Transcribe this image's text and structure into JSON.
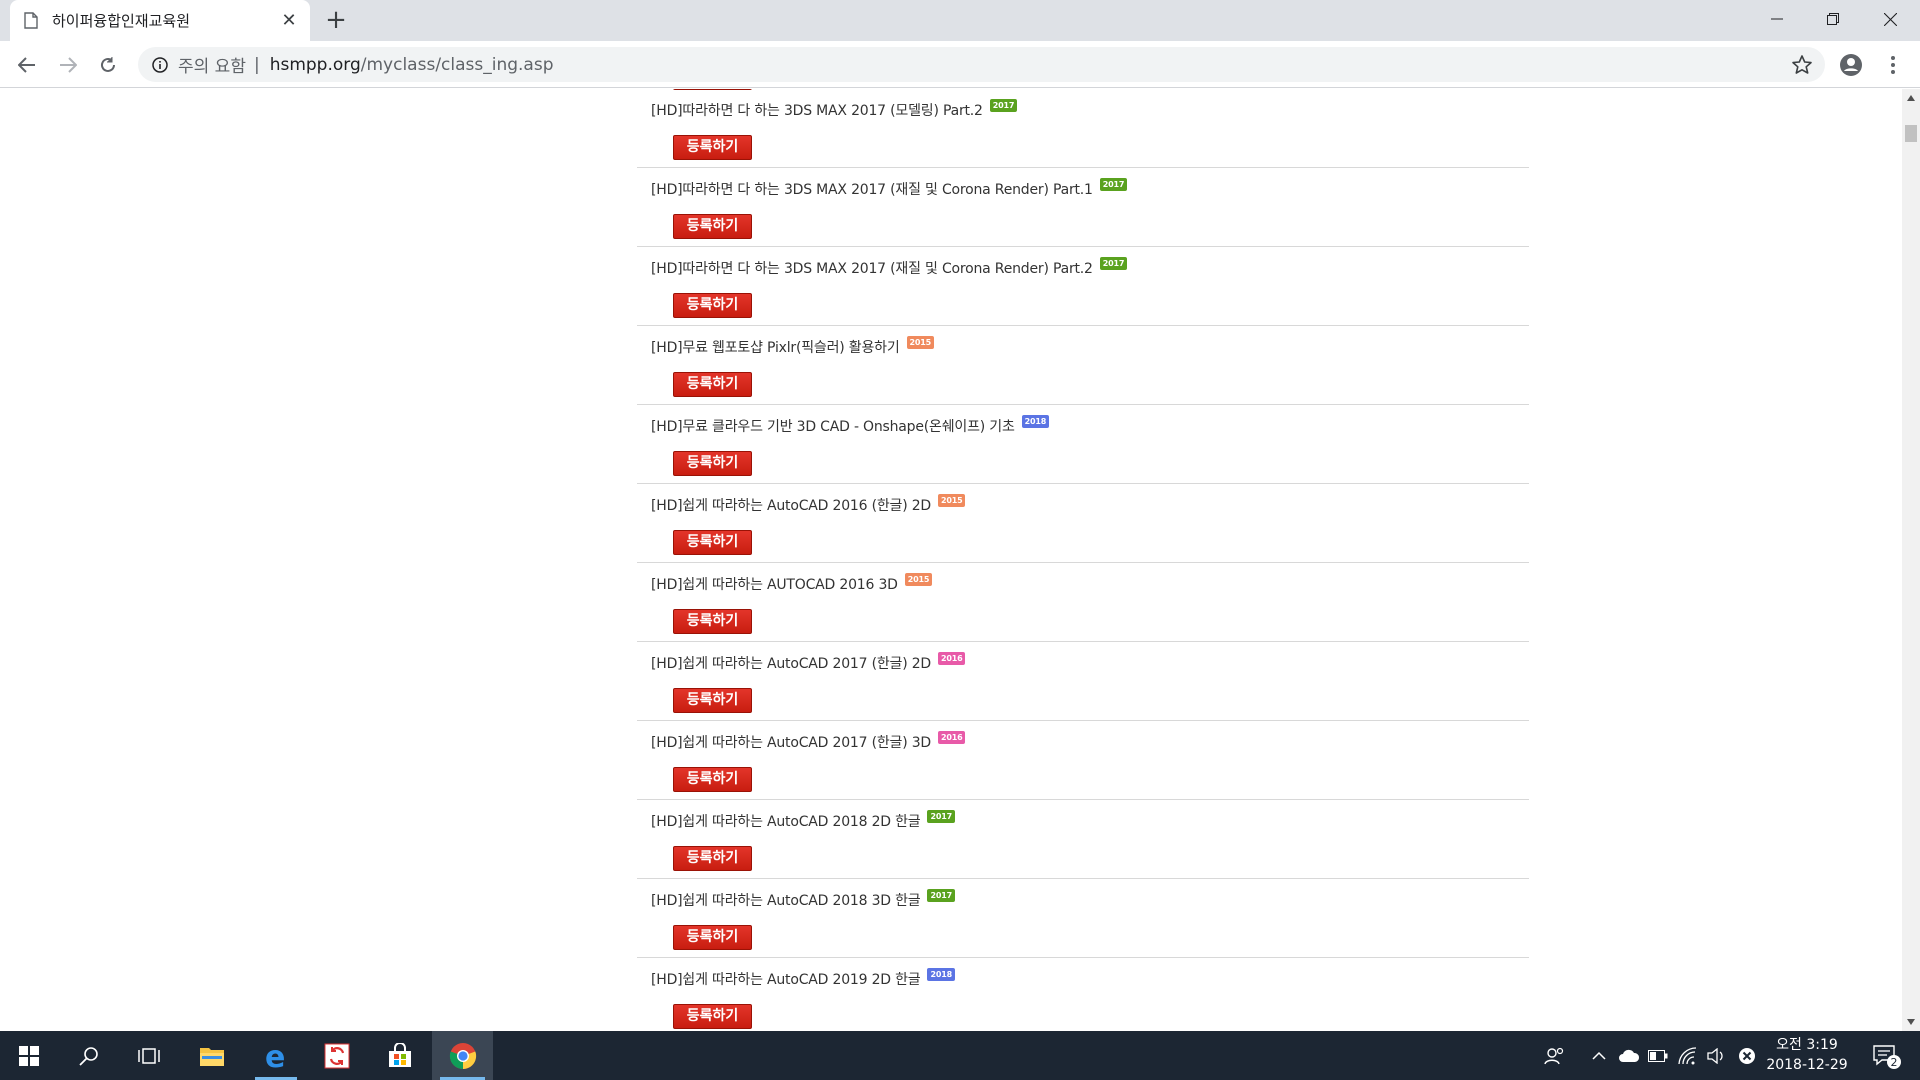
{
  "browser": {
    "tab_title": "하이퍼융합인재교육원",
    "tab_close": "✕",
    "new_tab": "+",
    "security_warning": "주의 요함",
    "separator": "|",
    "url_host": "hsmpp.org",
    "url_path": "/myclass/class_ing.asp"
  },
  "page": {
    "register_label": "등록하기",
    "courses": [
      {
        "title": "[HD]따라하면 다 하는 3DS MAX 2017 (모델링) Part.2",
        "badge": "2017",
        "badge_color": "#5aa21f"
      },
      {
        "title": "[HD]따라하면 다 하는 3DS MAX 2017 (재질 및 Corona Render) Part.1",
        "badge": "2017",
        "badge_color": "#5aa21f"
      },
      {
        "title": "[HD]따라하면 다 하는 3DS MAX 2017 (재질 및 Corona Render) Part.2",
        "badge": "2017",
        "badge_color": "#5aa21f"
      },
      {
        "title": "[HD]무료 웹포토샵 Pixlr(픽슬러) 활용하기",
        "badge": "2015",
        "badge_color": "#f08a5d"
      },
      {
        "title": "[HD]무료 클라우드 기반 3D CAD - Onshape(온쉐이프) 기초",
        "badge": "2018",
        "badge_color": "#5b74e4"
      },
      {
        "title": "[HD]쉽게 따라하는 AutoCAD 2016 (한글) 2D",
        "badge": "2015",
        "badge_color": "#f08a5d"
      },
      {
        "title": "[HD]쉽게 따라하는 AUTOCAD 2016 3D",
        "badge": "2015",
        "badge_color": "#f08a5d"
      },
      {
        "title": "[HD]쉽게 따라하는 AutoCAD 2017 (한글) 2D",
        "badge": "2016",
        "badge_color": "#e85aa8"
      },
      {
        "title": "[HD]쉽게 따라하는 AutoCAD 2017 (한글) 3D",
        "badge": "2016",
        "badge_color": "#e85aa8"
      },
      {
        "title": "[HD]쉽게 따라하는 AutoCAD 2018 2D 한글",
        "badge": "2017",
        "badge_color": "#5aa21f"
      },
      {
        "title": "[HD]쉽게 따라하는 AutoCAD 2018 3D 한글",
        "badge": "2017",
        "badge_color": "#5aa21f"
      },
      {
        "title": "[HD]쉽게 따라하는 AutoCAD 2019 2D 한글",
        "badge": "2018",
        "badge_color": "#5b74e4"
      }
    ]
  },
  "taskbar": {
    "time": "오전 3:19",
    "date": "2018-12-29",
    "notification_count": "2"
  }
}
